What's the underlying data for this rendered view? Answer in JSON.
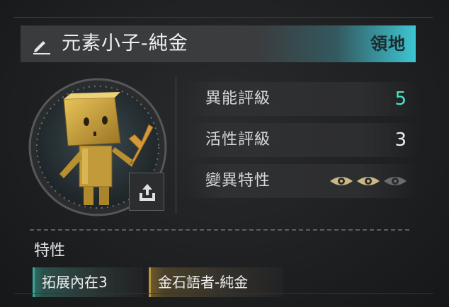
{
  "header": {
    "title": "元素小子-純金",
    "zone_badge": "領地",
    "edit_icon": "pencil-icon"
  },
  "portrait": {
    "alt_icon": "character-portrait",
    "export_icon": "share-export-icon"
  },
  "stats": [
    {
      "label": "異能評級",
      "value": "5",
      "accent": true
    },
    {
      "label": "活性評級",
      "value": "3",
      "accent": false
    },
    {
      "label": "變異特性",
      "eyes_active": 2,
      "eyes_total": 3
    }
  ],
  "traits": {
    "title": "特性",
    "tags": [
      {
        "label": "拓展內在3",
        "style": "teal"
      },
      {
        "label": "金石語者-純金",
        "style": "gold"
      }
    ]
  },
  "colors": {
    "accent_cyan": "#3ec5d3",
    "accent_green": "#4fe3c8",
    "eye_active": "#c9b884",
    "eye_inactive": "#6a6b6d",
    "gold": "#b9963d",
    "teal": "#3aa596"
  }
}
